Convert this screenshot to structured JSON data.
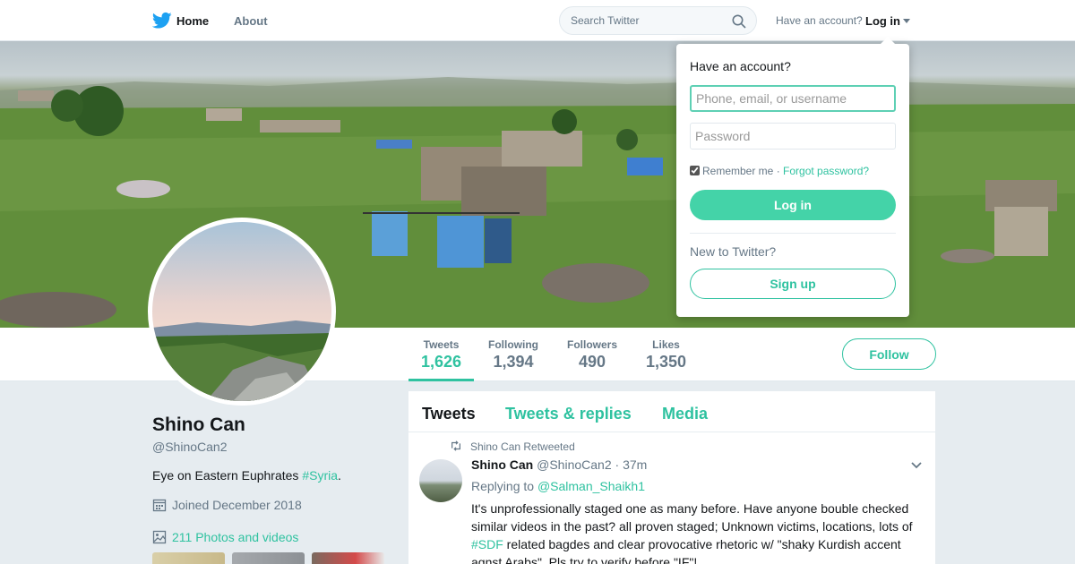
{
  "colors": {
    "accent": "#2fc2a0",
    "brand_blue": "#1da1f2",
    "text_primary": "#14171a",
    "text_secondary": "#657786",
    "background": "#e6ecf0"
  },
  "topnav": {
    "logo_icon": "twitter-bird-icon",
    "home_label": "Home",
    "about_label": "About",
    "search_placeholder": "Search Twitter",
    "search_icon": "search-icon",
    "account_prompt": "Have an account?",
    "login_label": "Log in"
  },
  "banner": {
    "image_description": "rural village landscape header photo"
  },
  "profile_nav": {
    "stats": [
      {
        "label": "Tweets",
        "value": "1,626",
        "active": true
      },
      {
        "label": "Following",
        "value": "1,394",
        "active": false
      },
      {
        "label": "Followers",
        "value": "490",
        "active": false
      },
      {
        "label": "Likes",
        "value": "1,350",
        "active": false
      }
    ],
    "follow_label": "Follow"
  },
  "profile": {
    "name": "Shino Can",
    "handle": "@ShinoCan2",
    "bio_text": "Eye on Eastern Euphrates ",
    "bio_hashtag": "#Syria",
    "bio_end": ".",
    "joined": "Joined December 2018",
    "photos_label": "211 Photos and videos"
  },
  "timeline": {
    "tabs": [
      {
        "label": "Tweets",
        "active": true
      },
      {
        "label": "Tweets & replies",
        "active": false
      },
      {
        "label": "Media",
        "active": false
      }
    ],
    "tweet": {
      "retweet_label": "Shino Can Retweeted",
      "author_name": "Shino Can",
      "author_handle": "@ShinoCan2",
      "time": "· 37m",
      "replying_prefix": "Replying to ",
      "replying_to": "@Salman_Shaikh1",
      "body_part1": "It's unprofessionally staged one as many before. Have anyone bouble checked similar videos in the past? all proven staged; Unknown victims, locations, lots of ",
      "body_hashtag": "#SDF",
      "body_part2": " related bagdes and clear provocative rhetoric w/ \"shaky Kurdish accent agnst Arabs\". Pls try to verify before \"IF\"!"
    }
  },
  "login_dropdown": {
    "title": "Have an account?",
    "username_placeholder": "Phone, email, or username",
    "password_placeholder": "Password",
    "remember_label": "Remember me",
    "separator": " · ",
    "forgot_label": "Forgot password?",
    "login_button": "Log in",
    "new_prompt": "New to Twitter?",
    "signup_button": "Sign up"
  }
}
